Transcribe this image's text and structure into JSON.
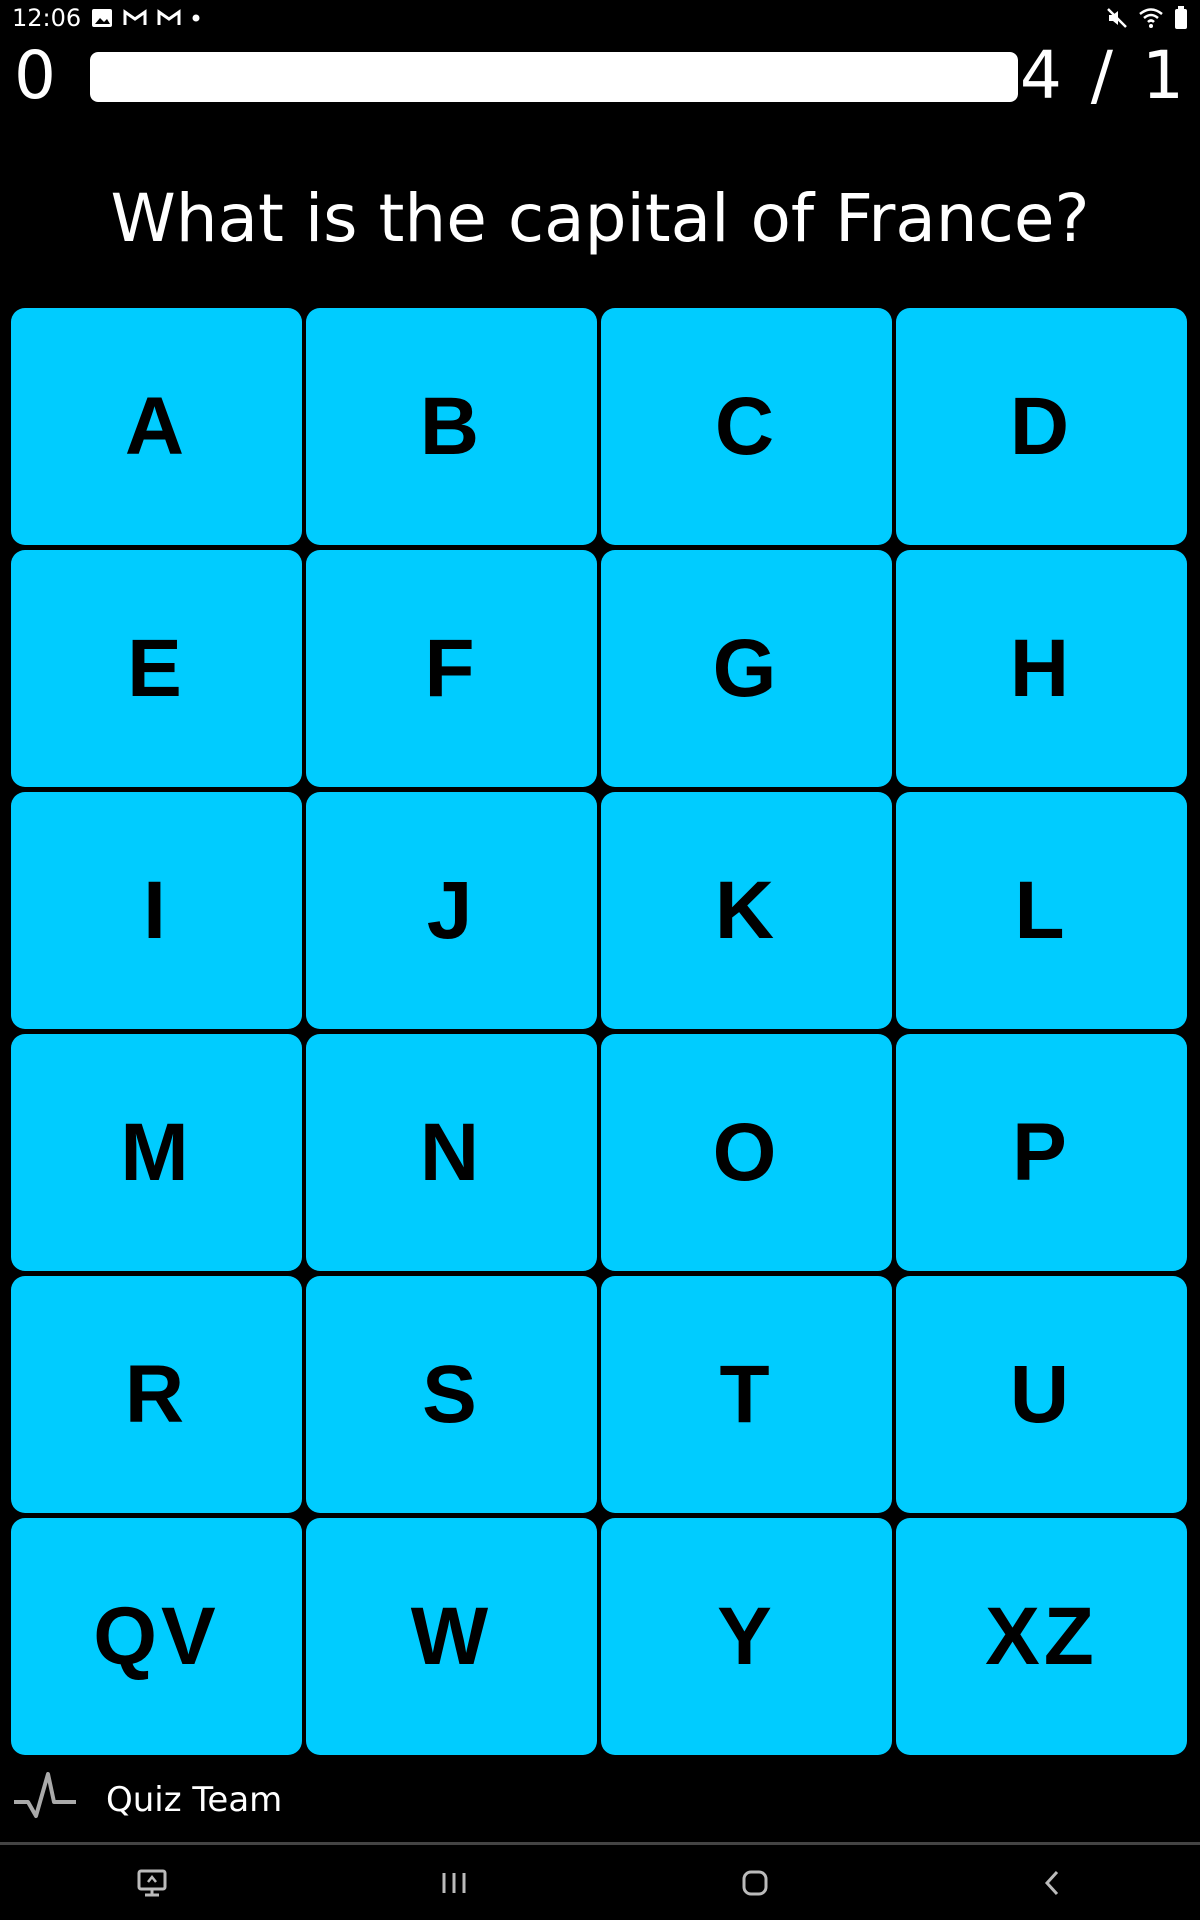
{
  "status_bar": {
    "time": "12:06",
    "left_icons": [
      "image-icon",
      "gmail-icon",
      "gmail-icon",
      "dot-icon"
    ],
    "right_icons": [
      "mute-icon",
      "wifi-icon",
      "battery-icon"
    ]
  },
  "quiz": {
    "score": "0",
    "counter": "4 / 1",
    "progress": 1.0,
    "question": "What is the capital of France?"
  },
  "tiles": [
    "A",
    "B",
    "C",
    "D",
    "E",
    "F",
    "G",
    "H",
    "I",
    "J",
    "K",
    "L",
    "M",
    "N",
    "O",
    "P",
    "R",
    "S",
    "T",
    "U",
    "QV",
    "W",
    "Y",
    "XZ"
  ],
  "colors": {
    "tile_bg": "#00ccff",
    "tile_text": "#000000",
    "background": "#000000",
    "progress_fill": "#ffffff"
  },
  "footer": {
    "brand_icon": "pulse-icon",
    "brand_label": "Quiz Team"
  },
  "nav_bar": {
    "icons": [
      "screen-share-icon",
      "recents-icon",
      "home-icon",
      "back-icon"
    ]
  }
}
